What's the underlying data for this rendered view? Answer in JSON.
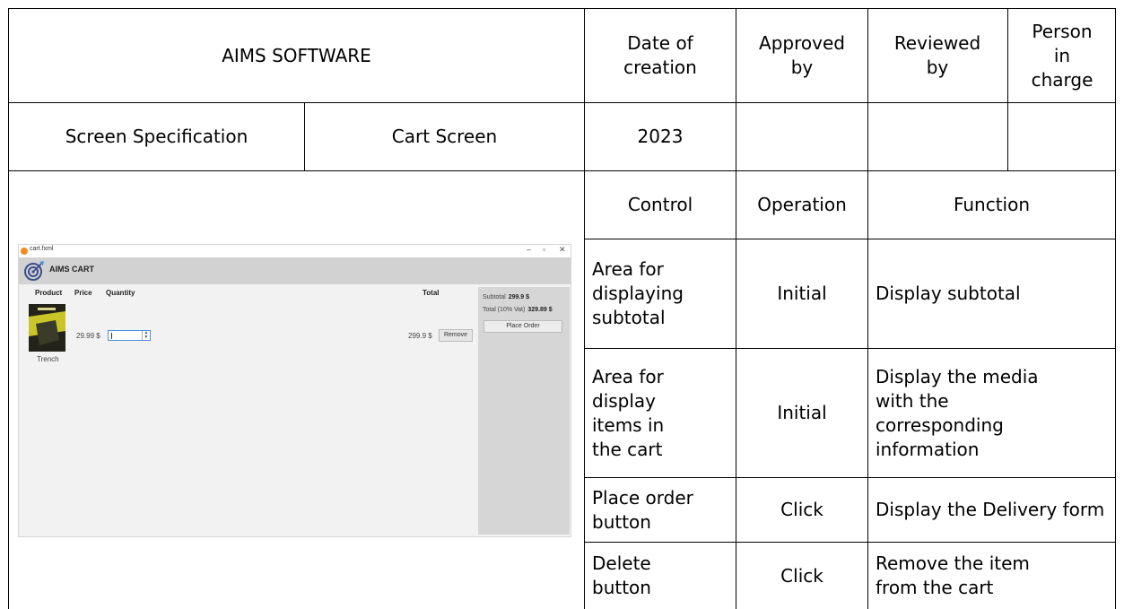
{
  "header": {
    "company": "AIMS SOFTWARE",
    "date_of_creation": "Date of creation",
    "approved_by": "Approved by",
    "reviewed_by": "Reviewed by",
    "person_in_charge": "Person in charge"
  },
  "info_row": {
    "doc_type": "Screen Specification",
    "screen_name": "Cart Screen",
    "year": "2023"
  },
  "spec_table": {
    "columns": [
      "Control",
      "Operation",
      "Function"
    ],
    "rows": [
      {
        "control": "Area for displaying subtotal",
        "operation": "Initial",
        "function": "Display subtotal"
      },
      {
        "control": "Area for display items in the cart",
        "operation": "Initial",
        "function": "Display the media with the corresponding information"
      },
      {
        "control": "Place order button",
        "operation": "Click",
        "function": "Display the Delivery form"
      },
      {
        "control": "Delete button",
        "operation": "Click",
        "function": "Remove the item from the cart"
      }
    ]
  },
  "mock_screen": {
    "window_title": "cart.fxml",
    "app_title": "AIMS CART",
    "columns": {
      "product": "Product",
      "price": "Price",
      "quantity": "Quantity",
      "total": "Total"
    },
    "item": {
      "name": "Trench",
      "price": "29.99 $",
      "total": "299.9 $",
      "remove_label": "Remove"
    },
    "summary": {
      "subtotal_label": "Subtotal",
      "subtotal_value": "299.9 $",
      "total_label": "Total (10% Vat)",
      "total_value": "329.89 $",
      "place_order_label": "Place Order"
    },
    "colors": {
      "accent": "#4a90e2",
      "header_bg": "#d2d2d2",
      "sidebar_bg": "#d6d6d6"
    }
  }
}
